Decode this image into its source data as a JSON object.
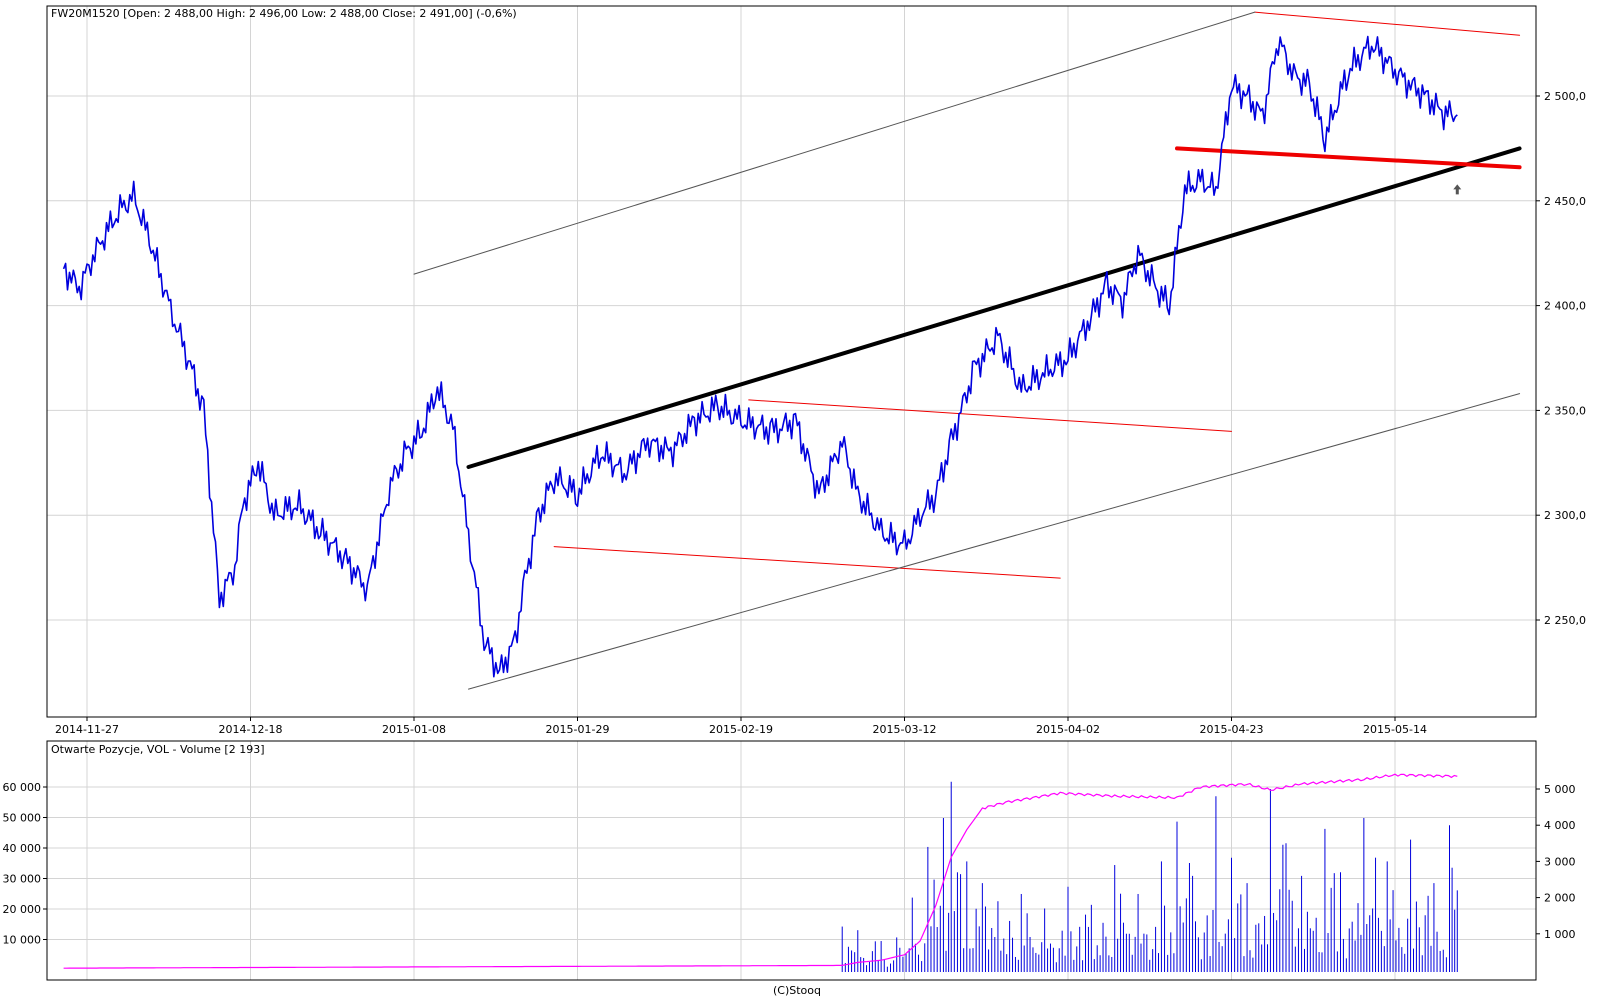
{
  "chart_data": [
    {
      "type": "line",
      "title": "FW20M1520 [Open: 2 488,00  High: 2 496,00  Low: 2 488,00  Close: 2 491,00] (-0,6%)",
      "x_labels": [
        "2014-11-27",
        "2014-12-18",
        "2015-01-08",
        "2015-01-29",
        "2015-02-19",
        "2015-03-12",
        "2015-04-02",
        "2015-04-23",
        "2015-05-14"
      ],
      "y_ticks": [
        "2 250,0",
        "2 300,0",
        "2 350,0",
        "2 400,0",
        "2 450,0",
        "2 500,0"
      ],
      "ylim": [
        2205,
        2550
      ],
      "grid": true,
      "series": [
        {
          "color": "#0000dd",
          "x": [
            "2014-11-24",
            "2014-11-26",
            "2014-11-28",
            "2014-12-01",
            "2014-12-03",
            "2014-12-05",
            "2014-12-08",
            "2014-12-10",
            "2014-12-12",
            "2014-12-14",
            "2014-12-16",
            "2014-12-17",
            "2014-12-19",
            "2014-12-21",
            "2014-12-24",
            "2014-12-27",
            "2014-12-30",
            "2015-01-02",
            "2015-01-05",
            "2015-01-07",
            "2015-01-09",
            "2015-01-11",
            "2015-01-13",
            "2015-01-15",
            "2015-01-17",
            "2015-01-19",
            "2015-01-21",
            "2015-01-22",
            "2015-01-24",
            "2015-01-26",
            "2015-01-29",
            "2015-02-01",
            "2015-02-04",
            "2015-02-07",
            "2015-02-10",
            "2015-02-13",
            "2015-02-16",
            "2015-02-19",
            "2015-02-23",
            "2015-02-26",
            "2015-03-01",
            "2015-03-04",
            "2015-03-06",
            "2015-03-09",
            "2015-03-12",
            "2015-03-14",
            "2015-03-16",
            "2015-03-18",
            "2015-03-21",
            "2015-03-24",
            "2015-03-27",
            "2015-03-30",
            "2015-04-02",
            "2015-04-05",
            "2015-04-07",
            "2015-04-09",
            "2015-04-11",
            "2015-04-13",
            "2015-04-15",
            "2015-04-17",
            "2015-04-19",
            "2015-04-21",
            "2015-04-23",
            "2015-04-25",
            "2015-04-27",
            "2015-04-29",
            "2015-05-01",
            "2015-05-03",
            "2015-05-05",
            "2015-05-08",
            "2015-05-11",
            "2015-05-14",
            "2015-05-16",
            "2015-05-18",
            "2015-05-20",
            "2015-05-22"
          ],
          "y": [
            2418,
            2408,
            2425,
            2445,
            2452,
            2432,
            2395,
            2375,
            2350,
            2260,
            2275,
            2305,
            2325,
            2300,
            2305,
            2292,
            2280,
            2265,
            2315,
            2330,
            2340,
            2360,
            2342,
            2290,
            2240,
            2225,
            2240,
            2265,
            2300,
            2318,
            2310,
            2330,
            2320,
            2335,
            2330,
            2345,
            2352,
            2345,
            2340,
            2345,
            2310,
            2335,
            2310,
            2292,
            2285,
            2300,
            2310,
            2335,
            2370,
            2385,
            2360,
            2368,
            2375,
            2395,
            2410,
            2402,
            2425,
            2410,
            2400,
            2455,
            2460,
            2455,
            2505,
            2500,
            2490,
            2527,
            2510,
            2505,
            2480,
            2512,
            2525,
            2512,
            2505,
            2500,
            2492,
            2491
          ]
        }
      ],
      "trendlines": [
        {
          "color": "#000000",
          "from": [
            "2015-01-15",
            2323
          ],
          "to": [
            "2015-05-30",
            2475
          ]
        },
        {
          "color": "#ee0000",
          "from": [
            "2015-04-16",
            2475
          ],
          "to": [
            "2015-05-30",
            2466
          ]
        },
        {
          "color": "#ee0000",
          "from": [
            "2015-04-26",
            2540
          ],
          "to": [
            "2015-05-30",
            2529
          ]
        },
        {
          "color": "#ee0000",
          "from": [
            "2015-02-20",
            2355
          ],
          "to": [
            "2015-04-23",
            2340
          ]
        },
        {
          "color": "#ee0000",
          "from": [
            "2015-01-26",
            2285
          ],
          "to": [
            "2015-04-01",
            2270
          ]
        },
        {
          "color": "#555555",
          "from": [
            "2015-01-08",
            2415
          ],
          "to": [
            "2015-04-26",
            2540
          ]
        },
        {
          "color": "#555555",
          "from": [
            "2015-01-15",
            2217
          ],
          "to": [
            "2015-05-30",
            2358
          ]
        }
      ],
      "marker": {
        "x": "2015-05-22",
        "y": 2455,
        "symbol": "arrow-up"
      }
    },
    {
      "type": "bar",
      "title": "Otwarte Pozycje, VOL - Volume [2 193]",
      "x_labels": [
        "(C)Stooq"
      ],
      "y_ticks_left": [
        "10 000",
        "20 000",
        "30 000",
        "40 000",
        "50 000",
        "60 000"
      ],
      "y_ticks_right": [
        "1 000",
        "2 000",
        "3 000",
        "4 000",
        "5 000"
      ],
      "ylim_left": [
        0,
        68000
      ],
      "ylim_right": [
        0,
        5600
      ],
      "grid": true,
      "series": [
        {
          "name": "Otwarte Pozycje",
          "type": "line",
          "color": "#ff00ff",
          "axis": "left",
          "x": [
            "2014-11-24",
            "2015-03-04",
            "2015-03-06",
            "2015-03-09",
            "2015-03-12",
            "2015-03-14",
            "2015-03-16",
            "2015-03-18",
            "2015-03-20",
            "2015-03-22",
            "2015-03-25",
            "2015-04-01",
            "2015-04-08",
            "2015-04-16",
            "2015-04-19",
            "2015-04-25",
            "2015-04-28",
            "2015-05-02",
            "2015-05-10",
            "2015-05-14",
            "2015-05-22"
          ],
          "y": [
            600,
            1500,
            2500,
            3200,
            5000,
            9500,
            21000,
            37000,
            46000,
            53000,
            55000,
            58000,
            57000,
            56500,
            60000,
            61000,
            59000,
            61000,
            62500,
            64000,
            63500
          ]
        },
        {
          "name": "VOL",
          "type": "bar",
          "color": "#0000dd",
          "axis": "right",
          "x": [
            "2015-03-04",
            "2015-03-06",
            "2015-03-09",
            "2015-03-11",
            "2015-03-13",
            "2015-03-15",
            "2015-03-17",
            "2015-03-18",
            "2015-03-20",
            "2015-03-22",
            "2015-03-24",
            "2015-03-27",
            "2015-03-30",
            "2015-04-02",
            "2015-04-05",
            "2015-04-08",
            "2015-04-11",
            "2015-04-14",
            "2015-04-16",
            "2015-04-18",
            "2015-04-21",
            "2015-04-23",
            "2015-04-25",
            "2015-04-28",
            "2015-04-30",
            "2015-05-02",
            "2015-05-05",
            "2015-05-07",
            "2015-05-10",
            "2015-05-13",
            "2015-05-16",
            "2015-05-19",
            "2015-05-21",
            "2015-05-22"
          ],
          "y": [
            1200,
            1100,
            800,
            900,
            2000,
            3400,
            4200,
            5200,
            3000,
            2400,
            1900,
            2100,
            1700,
            2300,
            1800,
            2900,
            2100,
            3000,
            4100,
            2600,
            4800,
            3100,
            2400,
            5000,
            3500,
            2600,
            3900,
            2700,
            4200,
            3000,
            3600,
            2400,
            4000,
            2200
          ]
        }
      ]
    }
  ]
}
